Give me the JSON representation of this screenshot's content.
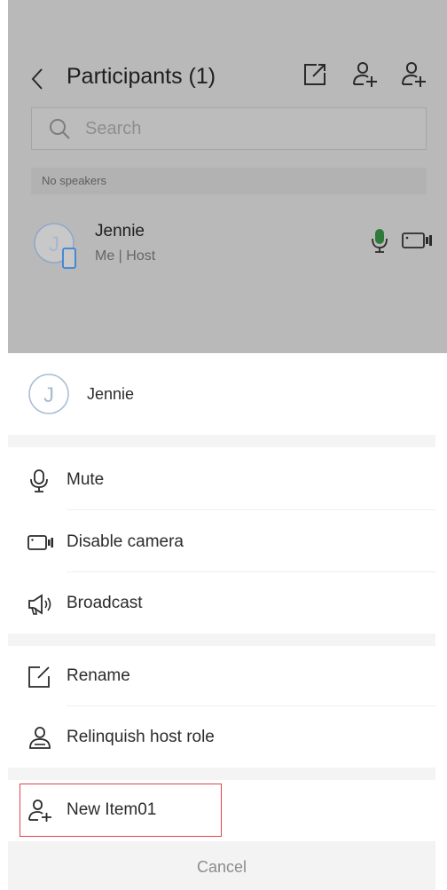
{
  "header": {
    "title": "Participants (1)",
    "icons": [
      "back-chevron-icon",
      "share-icon",
      "add-user-icon",
      "invite-user-icon"
    ]
  },
  "search": {
    "placeholder": "Search"
  },
  "speakers": {
    "label": "No speakers"
  },
  "participants": [
    {
      "initial": "J",
      "name": "Jennie",
      "role": "Me | Host",
      "mic": "on",
      "camera": "off"
    }
  ],
  "sheet": {
    "initial": "J",
    "name": "Jennie",
    "groups": [
      [
        {
          "icon": "microphone-icon",
          "label": "Mute"
        },
        {
          "icon": "camera-icon",
          "label": "Disable camera"
        },
        {
          "icon": "megaphone-icon",
          "label": "Broadcast"
        }
      ],
      [
        {
          "icon": "edit-icon",
          "label": "Rename"
        },
        {
          "icon": "host-role-icon",
          "label": "Relinquish host role"
        }
      ],
      [
        {
          "icon": "add-user-icon",
          "label": "New Item01"
        }
      ]
    ],
    "cancel": "Cancel"
  },
  "colors": {
    "accent_blue": "#3a82d6",
    "mic_green": "#2f7a3a",
    "highlight_red": "#e0434a"
  }
}
